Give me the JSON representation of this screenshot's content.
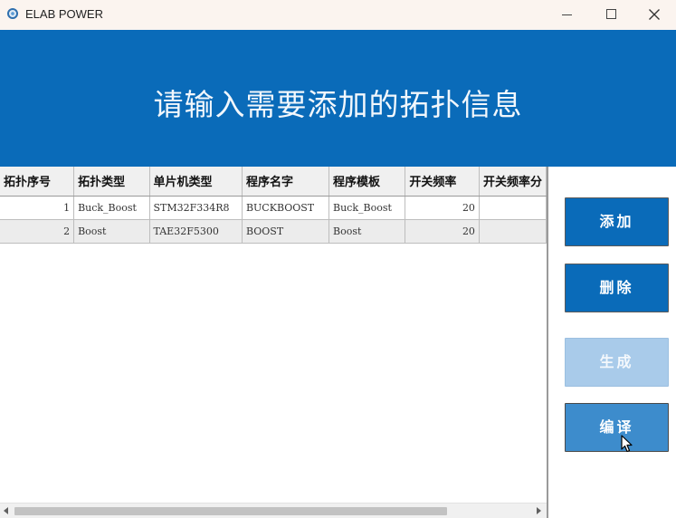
{
  "window": {
    "title": "ELAB POWER"
  },
  "banner": {
    "title": "请输入需要添加的拓扑信息"
  },
  "table": {
    "columns": [
      "拓扑序号",
      "拓扑类型",
      "单片机类型",
      "程序名字",
      "程序模板",
      "开关频率",
      "开关频率分"
    ],
    "rows": [
      [
        "1",
        "Buck_Boost",
        "STM32F334R8",
        "BUCKBOOST",
        "Buck_Boost",
        "20",
        ""
      ],
      [
        "2",
        "Boost",
        "TAE32F5300",
        "BOOST",
        "Boost",
        "20",
        ""
      ]
    ]
  },
  "actions": {
    "add": "添加",
    "delete": "删除",
    "generate": "生成",
    "compile": "编译"
  },
  "colors": {
    "accent": "#0a6bb9",
    "disabled": "#a9cbea"
  }
}
